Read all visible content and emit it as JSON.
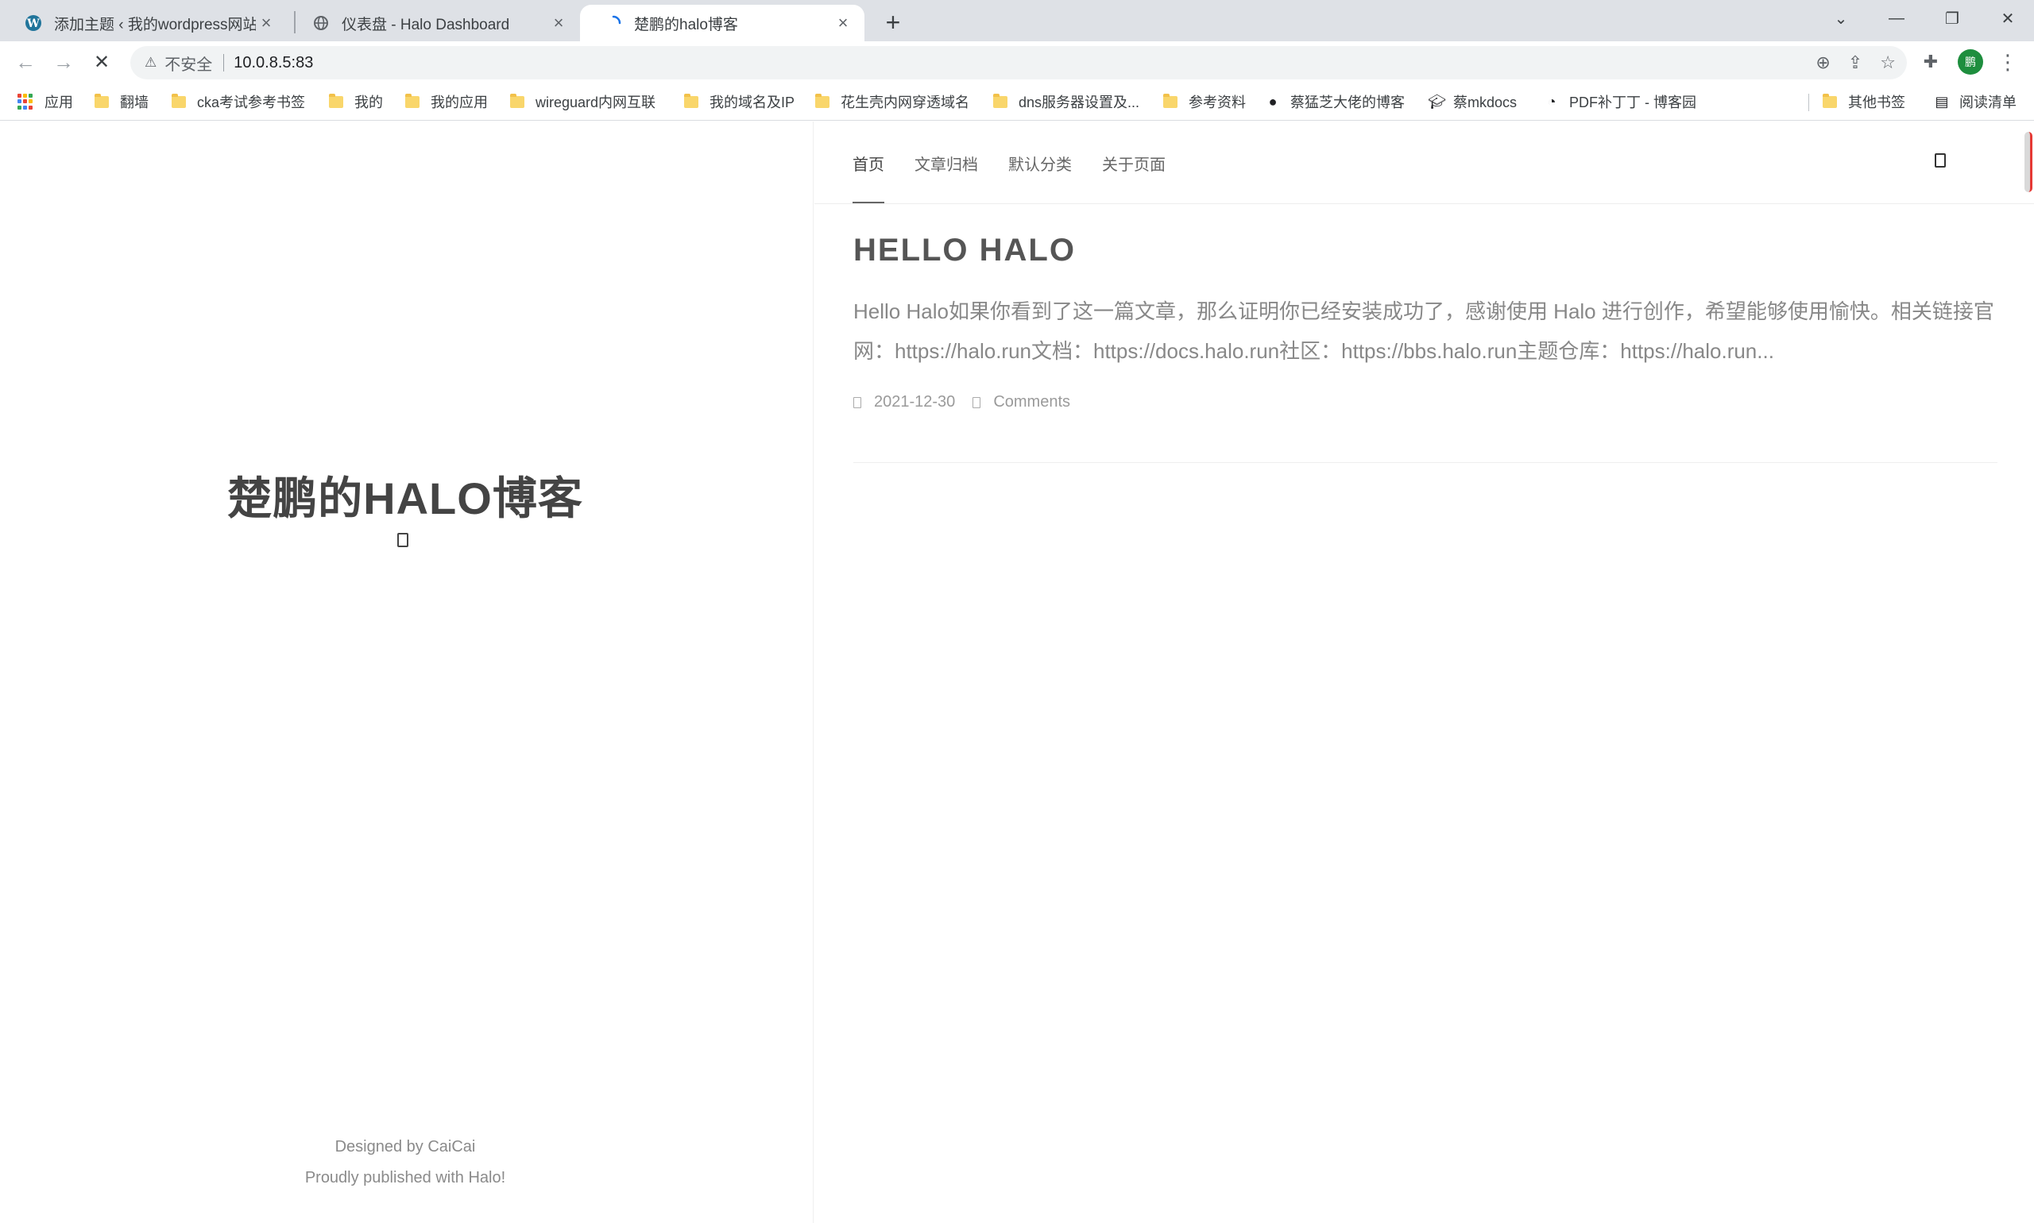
{
  "browser": {
    "tabs": [
      {
        "title": "添加主题 ‹ 我的wordpress网站 —",
        "close": "×"
      },
      {
        "title": "仪表盘 - Halo Dashboard",
        "close": "×"
      },
      {
        "title": "楚鹏的halo博客",
        "close": "×"
      }
    ],
    "new_tab": "+",
    "window_controls": {
      "menu": "⌄",
      "minimize": "—",
      "restore": "❐",
      "close": "✕"
    }
  },
  "toolbar": {
    "back": "←",
    "forward": "→",
    "stop": "✕",
    "security_icon": "⚠",
    "security_label": "不安全",
    "url": "10.0.8.5:83",
    "zoom_icon": "⊕",
    "share_icon": "⇪",
    "bookmark_star": "☆",
    "extensions_icon": "✚",
    "profile": "鹏",
    "menu_icon": "⋮"
  },
  "bookmarks": [
    {
      "label": "应用",
      "icon": "apps-grid-icon"
    },
    {
      "label": "翻墙",
      "icon": "folder-icon"
    },
    {
      "label": "cka考试参考书签",
      "icon": "folder-icon"
    },
    {
      "label": "我的",
      "icon": "folder-icon"
    },
    {
      "label": "我的应用",
      "icon": "folder-icon"
    },
    {
      "label": "wireguard内网互联",
      "icon": "folder-icon"
    },
    {
      "label": "我的域名及IP",
      "icon": "folder-icon"
    },
    {
      "label": "花生壳内网穿透域名",
      "icon": "folder-icon"
    },
    {
      "label": "dns服务器设置及...",
      "icon": "folder-icon"
    },
    {
      "label": "参考资料",
      "icon": "folder-icon"
    },
    {
      "label": "蔡猛芝大佬的博客",
      "icon": "site-icon"
    },
    {
      "label": "蔡mkdocs",
      "icon": "graduation-cap-icon"
    },
    {
      "label": "PDF补丁丁 - 博客园",
      "icon": "site-icon"
    },
    {
      "label": "其他书签",
      "icon": "folder-icon"
    },
    {
      "label": "阅读清单",
      "icon": "reading-list-icon"
    }
  ],
  "site": {
    "title": "楚鹏的HALO博客",
    "footer_designed": "Designed by CaiCai",
    "footer_published": "Proudly published with Halo!"
  },
  "nav": {
    "items": [
      "首页",
      "文章归档",
      "默认分类",
      "关于页面"
    ],
    "active_index": 0
  },
  "post": {
    "title": "HELLO HALO",
    "excerpt": "Hello Halo如果你看到了这一篇文章，那么证明你已经安装成功了，感谢使用 Halo 进行创作，希望能够使用愉快。相关链接官网：https://halo.run文档：https://docs.halo.run社区：https://bbs.halo.run主题仓库：https://halo.run...",
    "date": "2021-12-30",
    "comments": "Comments"
  }
}
